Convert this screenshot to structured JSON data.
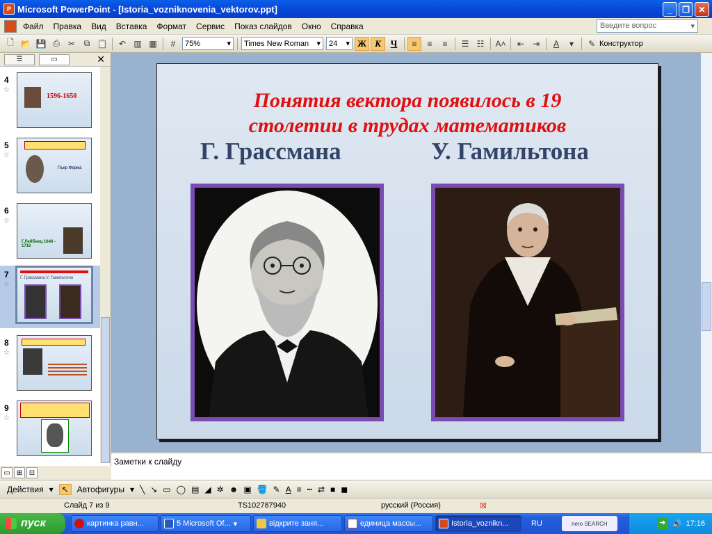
{
  "window": {
    "title": "Microsoft PowerPoint - [Istoria_vozniknovenia_vektorov.ppt]"
  },
  "menu": {
    "items": [
      "Файл",
      "Правка",
      "Вид",
      "Вставка",
      "Формат",
      "Сервис",
      "Показ слайдов",
      "Окно",
      "Справка"
    ],
    "help_placeholder": "Введите вопрос"
  },
  "toolbar": {
    "zoom": "75%",
    "font_name": "Times New Roman",
    "font_size": "24",
    "bold": "Ж",
    "italic": "К",
    "underline": "Ч",
    "designer": "Конструктор"
  },
  "slides_panel": {
    "slides": [
      {
        "number": "4",
        "text": "1596-1650"
      },
      {
        "number": "5",
        "text": "Пьер Ферма"
      },
      {
        "number": "6",
        "text": "Г.Лейбниц 1646 - 1716"
      },
      {
        "number": "7",
        "text": "Г. Грассмана  У. Гамильтона",
        "selected": true
      },
      {
        "number": "8",
        "text": ""
      },
      {
        "number": "9",
        "text": ""
      }
    ]
  },
  "slide": {
    "title_line1": "Понятия вектора появилось  в 19",
    "title_line2": "столетии в трудах  математиков",
    "name_left": "Г. Грассмана",
    "name_right": "У. Гамильтона",
    "colors": {
      "title": "#e01010",
      "names": "#334466",
      "frame": "#7a4bb0"
    }
  },
  "notes": {
    "placeholder": "Заметки к слайду"
  },
  "drawing": {
    "actions": "Действия",
    "autoshapes": "Автофигуры"
  },
  "status": {
    "slide": "Слайд 7 из 9",
    "template": "TS102787940",
    "language": "русский (Россия)"
  },
  "taskbar": {
    "start": "пуск",
    "tasks": [
      "картинка равн...",
      "5 Microsoft Of...",
      "відкрите заня...",
      "единица массы...",
      "Istoria_voznikn..."
    ],
    "lang": "RU",
    "search": "nero SEARCH",
    "clock": "17:16"
  }
}
